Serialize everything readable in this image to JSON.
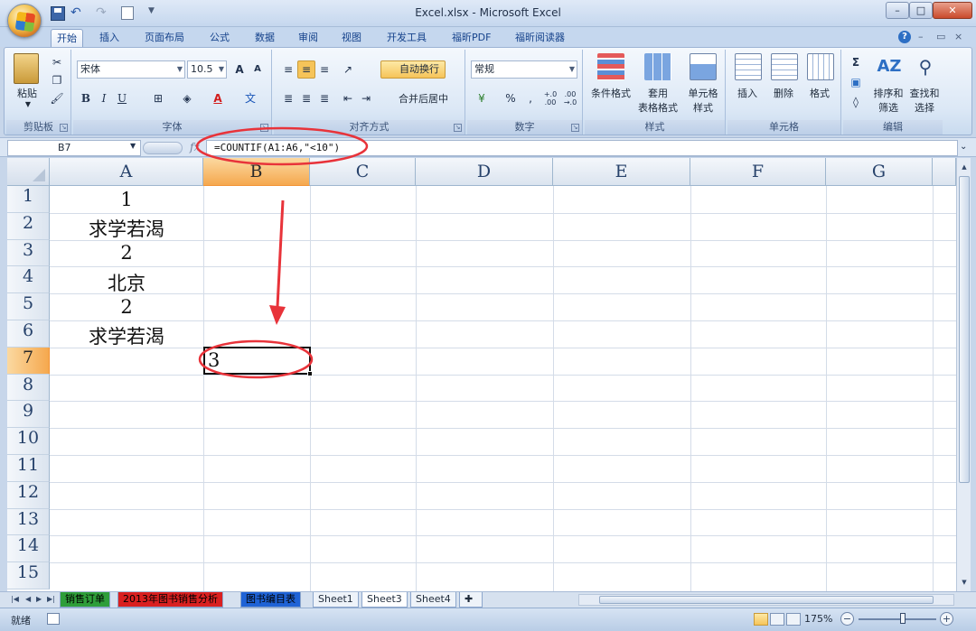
{
  "window": {
    "title": "Excel.xlsx - Microsoft Excel",
    "minimize": "–",
    "maximize": "□",
    "close": "✕"
  },
  "tabs": [
    "开始",
    "插入",
    "页面布局",
    "公式",
    "数据",
    "审阅",
    "视图",
    "开发工具",
    "福昕PDF",
    "福昕阅读器"
  ],
  "active_tab": "开始",
  "ribbon": {
    "clipboard": {
      "label": "剪贴板",
      "paste": "粘贴"
    },
    "font": {
      "label": "字体",
      "font_name": "宋体",
      "font_size": "10.5",
      "grow": "A",
      "shrink": "A",
      "bold": "B",
      "italic": "I",
      "underline": "U",
      "font_color": "A",
      "phonetic": "文"
    },
    "alignment": {
      "label": "对齐方式",
      "wrap_text": "自动换行",
      "merge_center": "合并后居中"
    },
    "number": {
      "label": "数字",
      "format": "常规",
      "percent": "%",
      "comma": ",",
      "inc_decimal": "+.0\n.00",
      "dec_decimal": ".00\n→.0"
    },
    "styles": {
      "label": "样式",
      "conditional": "条件格式",
      "table_format_1": "套用",
      "table_format_2": "表格格式",
      "cell_styles_1": "单元格",
      "cell_styles_2": "样式"
    },
    "cells": {
      "label": "单元格",
      "insert": "插入",
      "delete": "删除",
      "format": "格式"
    },
    "editing": {
      "label": "编辑",
      "sigma": "Σ",
      "sort_1": "排序和",
      "sort_2": "筛选",
      "find_1": "查找和",
      "find_2": "选择"
    }
  },
  "formula_bar": {
    "name_box": "B7",
    "fx": "fx",
    "formula": "=COUNTIF(A1:A6,\"<10\")"
  },
  "columns": [
    "A",
    "B",
    "C",
    "D",
    "E",
    "F",
    "G"
  ],
  "selected_column": "B",
  "rows": [
    "1",
    "2",
    "3",
    "4",
    "5",
    "6",
    "7",
    "8",
    "9",
    "10",
    "11",
    "12",
    "13",
    "14",
    "15"
  ],
  "selected_row": "7",
  "cells": {
    "A1": "1",
    "A2": "求学若渴",
    "A3": "2",
    "A4": "北京",
    "A5": "2",
    "A6": "求学若渴",
    "B7": "3"
  },
  "sheet_tabs": [
    "销售订单",
    "2013年图书销售分析",
    "图书编目表",
    "Sheet1",
    "Sheet3",
    "Sheet4"
  ],
  "active_sheet": "Sheet3",
  "status": {
    "ready": "就绪",
    "zoom": "175%"
  },
  "colors": {
    "accent": "#f5a84e",
    "annotation": "#e8333a",
    "tab_sales": "#2e9e3a",
    "tab_analysis": "#d92020",
    "tab_catalog": "#1f63d6"
  }
}
